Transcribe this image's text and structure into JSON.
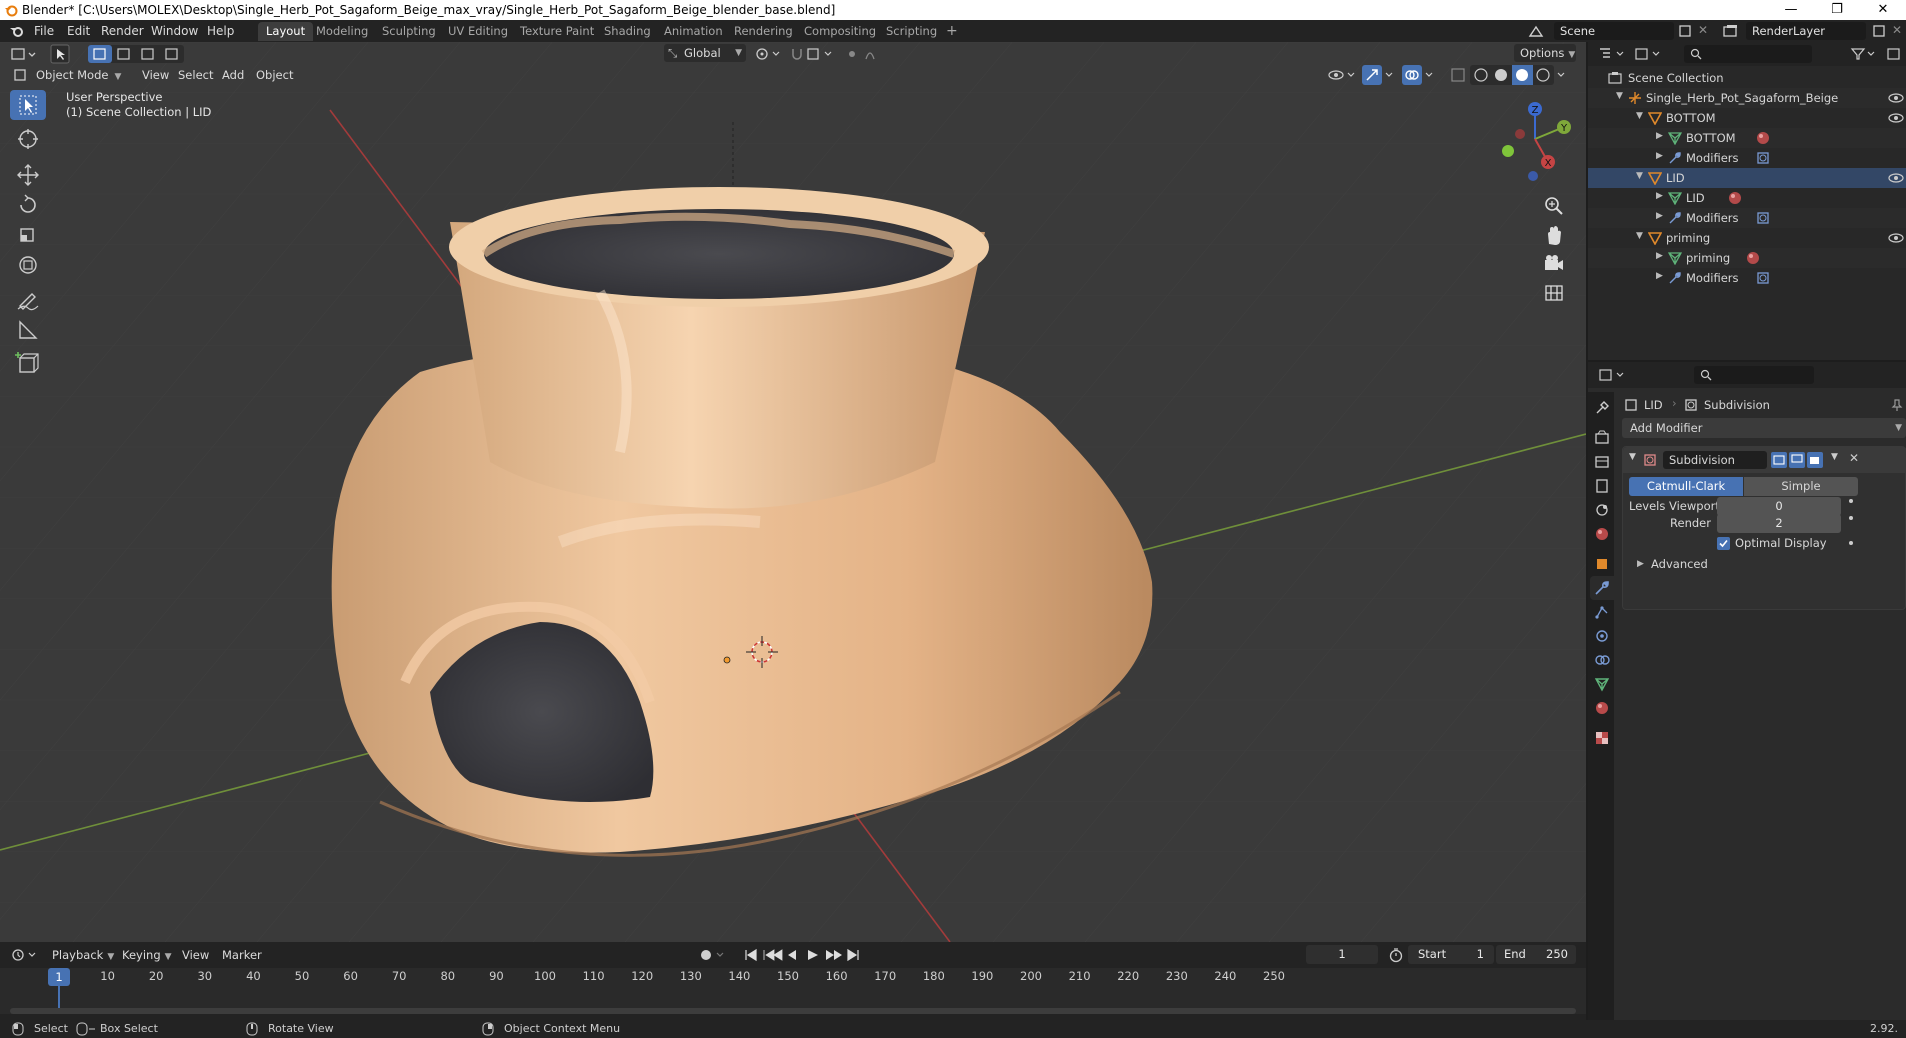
{
  "window": {
    "title": "Blender* [C:\\Users\\MOLEX\\Desktop\\Single_Herb_Pot_Sagaform_Beige_max_vray/Single_Herb_Pot_Sagaform_Beige_blender_base.blend]",
    "minimize": "—",
    "maximize": "❐",
    "close": "✕"
  },
  "menu": {
    "file": "File",
    "edit": "Edit",
    "render": "Render",
    "window": "Window",
    "help": "Help"
  },
  "workspaces": [
    "Layout",
    "Modeling",
    "Sculpting",
    "UV Editing",
    "Texture Paint",
    "Shading",
    "Animation",
    "Rendering",
    "Compositing",
    "Scripting"
  ],
  "workspace_add": "+",
  "scene_field": "Scene",
  "view_layer_field": "RenderLayer",
  "viewport": {
    "mode": "Object Mode",
    "view_menu": "View",
    "select_menu": "Select",
    "add_menu": "Add",
    "object_menu": "Object",
    "transform_orientation": "Global",
    "options": "Options",
    "perspective_label": "User Perspective",
    "collection_label": "(1) Scene Collection | LID",
    "axis_labels": {
      "z": "Z",
      "y": "Y",
      "x": "X"
    }
  },
  "timeline": {
    "playback": "Playback",
    "keying": "Keying",
    "view": "View",
    "marker": "Marker",
    "current_frame": "1",
    "start_label": "Start",
    "start_value": "1",
    "end_label": "End",
    "end_value": "250",
    "ticks": [
      "10",
      "20",
      "30",
      "40",
      "50",
      "60",
      "70",
      "80",
      "90",
      "100",
      "110",
      "120",
      "130",
      "140",
      "150",
      "160",
      "170",
      "180",
      "190",
      "200",
      "210",
      "220",
      "230",
      "240",
      "250"
    ],
    "playhead_label": "1"
  },
  "statusbar": {
    "select": "Select",
    "box_select": "Box Select",
    "rotate_view": "Rotate View",
    "context_menu": "Object Context Menu",
    "version": "2.92."
  },
  "outliner": {
    "rows": [
      {
        "label": "Scene Collection"
      },
      {
        "label": "Single_Herb_Pot_Sagaform_Beige"
      },
      {
        "label": "BOTTOM"
      },
      {
        "label": "BOTTOM"
      },
      {
        "label": "Modifiers"
      },
      {
        "label": "LID"
      },
      {
        "label": "LID"
      },
      {
        "label": "Modifiers"
      },
      {
        "label": "priming"
      },
      {
        "label": "priming"
      },
      {
        "label": "Modifiers"
      }
    ]
  },
  "properties": {
    "object_name": "LID",
    "modifier_breadcrumb": "Subdivision",
    "add_modifier": "Add Modifier",
    "modifier_name": "Subdivision",
    "catmull_clark": "Catmull-Clark",
    "simple": "Simple",
    "levels_viewport_label": "Levels Viewport",
    "levels_viewport_value": "0",
    "render_label": "Render",
    "render_value": "2",
    "optimal_display": "Optimal Display",
    "advanced": "Advanced"
  },
  "colors": {
    "accent": "#4772b3",
    "object_orange": "#e0892b",
    "mesh_green": "#5fb37a",
    "modifier_blue": "#7a9bd4",
    "pot_beige": "#e3b489",
    "axis_red": "#b33a3a",
    "axis_green": "#7fa83a"
  }
}
